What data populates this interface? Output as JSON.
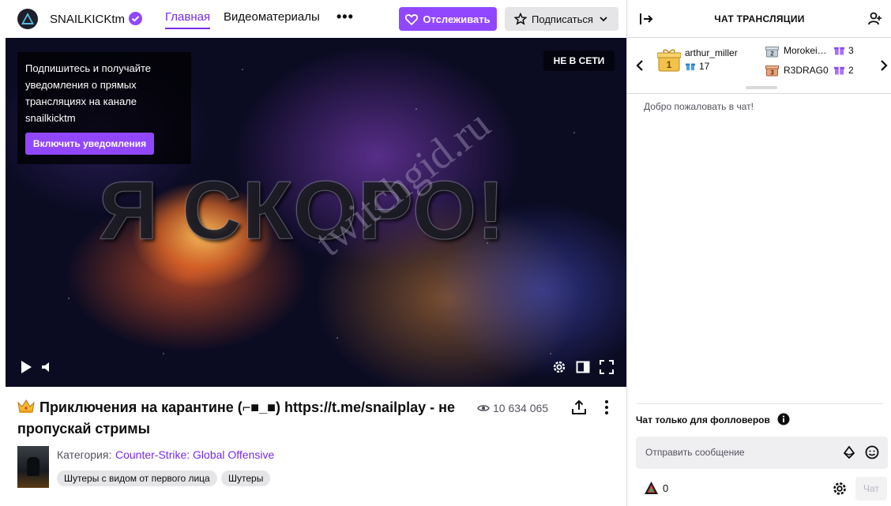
{
  "header": {
    "channel_name": "SNAILKICKtm",
    "nav_home": "Главная",
    "nav_videos": "Видеоматериалы",
    "nav_more": "•••",
    "follow_label": "Отслеживать",
    "subscribe_label": "Подписаться",
    "accent_color": "#9147ff"
  },
  "player": {
    "notification_text": "Подпишитесь и получайте уведомления о прямых трансляциях на канале snailkicktm",
    "notification_button": "Включить уведомления",
    "status_badge": "НЕ В СЕТИ",
    "overlay_title": "Я СКОРО!",
    "watermark": "twitchgid.ru"
  },
  "stream": {
    "title": "Приключения на карантине (⌐■_■) https://t.me/snailplay - не пропускай стримы",
    "viewers": "10 634 065",
    "category_label": "Категория:",
    "category": "Counter-Strike: Global Offensive",
    "tags": [
      "Шутеры с видом от первого лица",
      "Шутеры"
    ]
  },
  "chat": {
    "title": "ЧАТ ТРАНСЛЯЦИИ",
    "top_gifter": {
      "name": "arthur_miller",
      "count": "17",
      "rank": "1"
    },
    "gifters": [
      {
        "name": "Morokei…",
        "count": "3",
        "rank": "2"
      },
      {
        "name": "R3DRAG0",
        "count": "2",
        "rank": "3"
      }
    ],
    "welcome": "Добро пожаловать в чат!",
    "followers_only": "Чат только для фолловеров",
    "input_placeholder": "Отправить сообщение",
    "points": "0",
    "send_label": "Чат"
  }
}
